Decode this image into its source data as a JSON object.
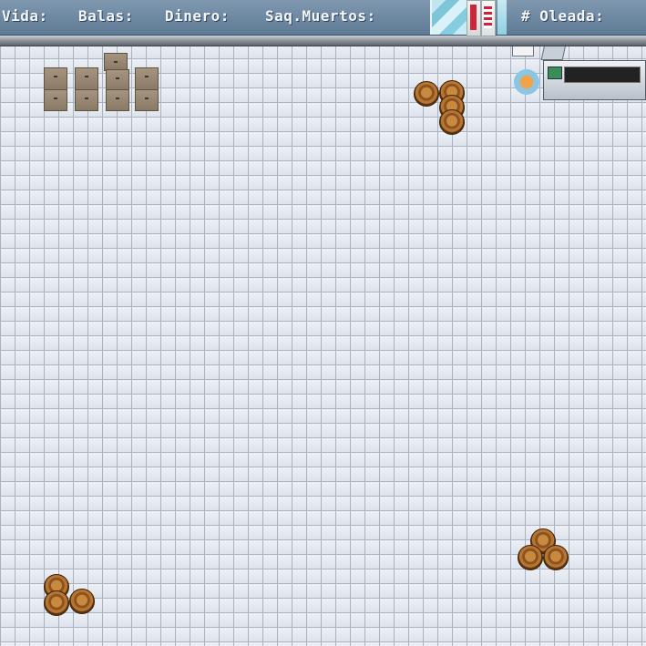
{
  "hud": {
    "vida_label": "Vida:",
    "balas_label": "Balas:",
    "dinero_label": "Dinero:",
    "saqueos_label": "Saq.Muertos:",
    "oleada_label": "# Oleada:"
  },
  "sprites": {
    "box_stack": "cardboard-boxes",
    "barrel_cluster": "wooden-barrels",
    "counter": "shop-counter"
  },
  "colors": {
    "hud_bg": "#6c86a0",
    "floor_tile": "#e3e8f0",
    "grid_line": "#a9b3c1"
  }
}
